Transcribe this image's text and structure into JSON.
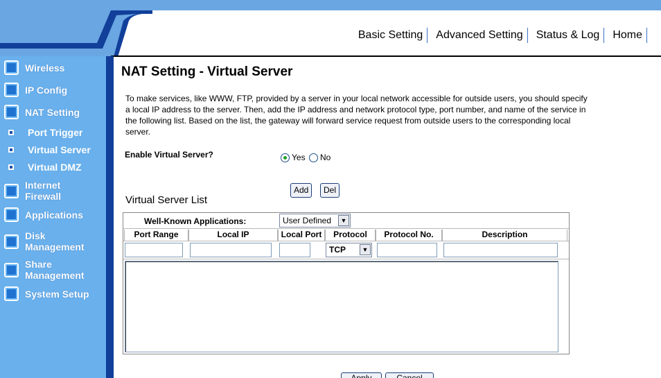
{
  "nav": {
    "basic_setting": "Basic Setting",
    "advanced_setting": "Advanced Setting",
    "status_log": "Status & Log",
    "home": "Home"
  },
  "sidebar": {
    "items": [
      {
        "label": "Wireless"
      },
      {
        "label": "IP Config"
      },
      {
        "label": "NAT Setting"
      },
      {
        "label": "Internet\nFirewall"
      },
      {
        "label": "Applications"
      },
      {
        "label": "Disk\nManagement"
      },
      {
        "label": "Share\nManagement"
      },
      {
        "label": "System Setup"
      }
    ],
    "subitems": [
      {
        "label": "Port Trigger"
      },
      {
        "label": "Virtual Server"
      },
      {
        "label": "Virtual DMZ"
      }
    ]
  },
  "main": {
    "title": "NAT Setting - Virtual Server",
    "intro": "To make services, like WWW, FTP, provided by a server in your local network accessible for outside users, you should specify a local IP address to the server. Then, add the IP address and network protocol type, port number, and name of the service in the following list. Based on the list, the gateway will forward service request from outside users to the corresponding local server.",
    "enable_label": "Enable Virtual Server?",
    "yes_label": "Yes",
    "no_label": "No",
    "enable_value": "Yes",
    "add_button": "Add",
    "del_button": "Del",
    "list_title": "Virtual Server List",
    "well_known_label": "Well-Known Applications:",
    "well_known_value": "User Defined",
    "columns": [
      "Port Range",
      "Local IP",
      "Local Port",
      "Protocol",
      "Protocol No.",
      "Description"
    ],
    "protocol_value": "TCP",
    "apply_button": "Apply",
    "cancel_button": "Cancel"
  },
  "colors": {
    "sidebar_bg": "#69b0ec",
    "sidebar_edge": "#113f9a",
    "banner_bg": "#6aa6e2"
  }
}
